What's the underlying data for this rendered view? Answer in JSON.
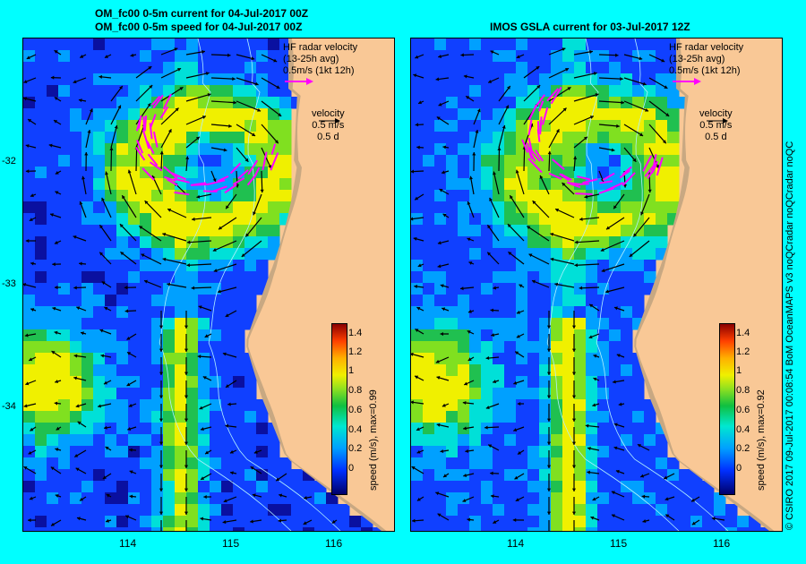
{
  "left_panel": {
    "title_line1": "OM_fc00 0-5m current for 04-Jul-2017 00Z",
    "title_line2": "OM_fc00 0-5m speed for 04-Jul-2017 00Z",
    "colorbar_label": "speed (m/s), max=0.99",
    "seed": 7
  },
  "right_panel": {
    "title_line1": "IMOS GSLA current for 03-Jul-2017 12Z",
    "colorbar_label": "speed (m/s), max=0.92",
    "seed": 13
  },
  "hf_legend": {
    "line1": "HF radar velocity",
    "line2": "(13-25h avg)",
    "line3": "0.5m/s (1kt 12h)",
    "arrow_color": "#ff00ff"
  },
  "velocity_legend": {
    "line1": "velocity",
    "line2": "0.5 m/s",
    "line3": "0.5 d"
  },
  "colorbar_ticks": [
    "1.4",
    "1.2",
    "1",
    "0.8",
    "0.6",
    "0.4",
    "0.2",
    "0"
  ],
  "y_ticks": [
    "-32",
    "-33",
    "-34"
  ],
  "x_ticks": [
    "114",
    "115",
    "116"
  ],
  "credit": "© CSIRO 2017   09-Jul-2017 00:08:54 BoM OceanMAPS v3 noQCradar noQCradar noQC",
  "colors": {
    "land": "#f9c896",
    "shelf": "#c8a882",
    "frame_bg": "#00ffff"
  }
}
